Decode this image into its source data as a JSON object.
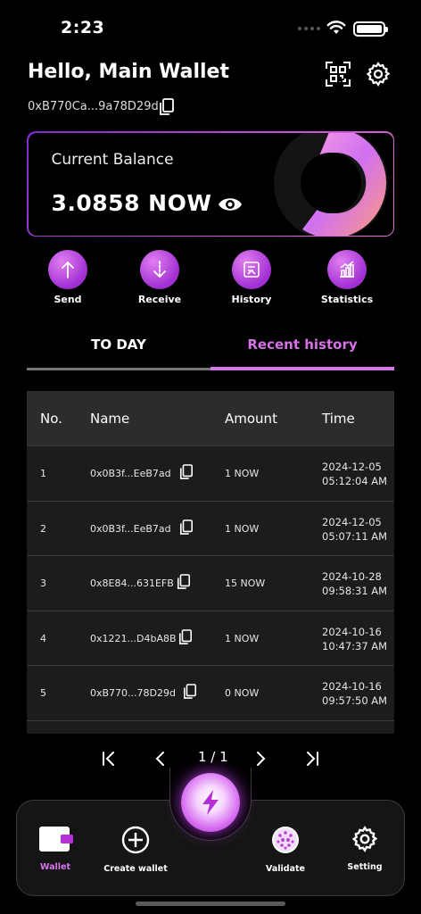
{
  "status_bar": {
    "time": "2:23"
  },
  "header": {
    "greeting": "Hello, Main Wallet",
    "address": "0xB770Ca...9a78D29d"
  },
  "balance": {
    "label": "Current Balance",
    "value": "3.0858 NOW"
  },
  "actions": [
    {
      "label": "Send",
      "icon": "arrow-up-icon"
    },
    {
      "label": "Receive",
      "icon": "arrow-down-icon"
    },
    {
      "label": "History",
      "icon": "history-icon"
    },
    {
      "label": "Statistics",
      "icon": "statistics-icon"
    }
  ],
  "tabs": {
    "today": "TO DAY",
    "recent": "Recent history",
    "active": "recent"
  },
  "table": {
    "headers": {
      "no": "No.",
      "name": "Name",
      "amount": "Amount",
      "time": "Time"
    },
    "rows": [
      {
        "no": "1",
        "name": "0x0B3f...EeB7ad",
        "amount": "1 NOW",
        "date": "2024-12-05",
        "clock": "05:12:04 AM"
      },
      {
        "no": "2",
        "name": "0x0B3f...EeB7ad",
        "amount": "1 NOW",
        "date": "2024-12-05",
        "clock": "05:07:11 AM"
      },
      {
        "no": "3",
        "name": "0x8E84...631EFB",
        "amount": "15 NOW",
        "date": "2024-10-28",
        "clock": "09:58:31 AM"
      },
      {
        "no": "4",
        "name": "0x1221...D4bA8B",
        "amount": "1 NOW",
        "date": "2024-10-16",
        "clock": "10:47:37 AM"
      },
      {
        "no": "5",
        "name": "0xB770...78D29d",
        "amount": "0 NOW",
        "date": "2024-10-16",
        "clock": "09:57:50 AM"
      }
    ]
  },
  "pager": {
    "page": "1 / 1"
  },
  "nav": {
    "wallet": "Wallet",
    "create_wallet": "Create wallet",
    "validate": "Validate",
    "setting": "Setting"
  },
  "colors": {
    "accent": "#d874ec",
    "accent_dark": "#a12fd3",
    "background": "#000000"
  }
}
